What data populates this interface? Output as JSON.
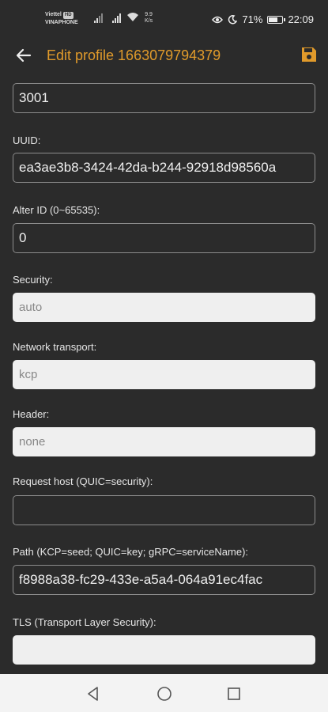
{
  "status": {
    "carrier1": "Viettel",
    "hd": "HD",
    "carrier2": "VINAPHONE",
    "speed_value": "9.9",
    "speed_unit": "K/s",
    "battery": "71%",
    "battery_level": 0.71,
    "time": "22:09"
  },
  "appbar": {
    "title": "Edit profile 1663079794379"
  },
  "form": {
    "port_value": "3001",
    "uuid_label": "UUID:",
    "uuid_value": "ea3ae3b8-3424-42da-b244-92918d98560a",
    "alter_label": "Alter ID (0~65535):",
    "alter_value": "0",
    "security_label": "Security:",
    "security_value": "auto",
    "network_label": "Network transport:",
    "network_value": "kcp",
    "header_label": "Header:",
    "header_value": "none",
    "host_label": "Request host (QUIC=security):",
    "host_value": "",
    "path_label": "Path (KCP=seed; QUIC=key; gRPC=serviceName):",
    "path_value": "f8988a38-fc29-433e-a5a4-064a91ec4fac",
    "tls_label": "TLS (Transport Layer Security):",
    "tls_value": ""
  },
  "colors": {
    "accent": "#e09a2b",
    "background": "#2b2b2b"
  },
  "icons": [
    "back-arrow-icon",
    "save-icon",
    "nav-back-icon",
    "nav-home-icon",
    "nav-recents-icon",
    "wifi-icon",
    "eye-icon",
    "moon-icon",
    "battery-icon"
  ]
}
